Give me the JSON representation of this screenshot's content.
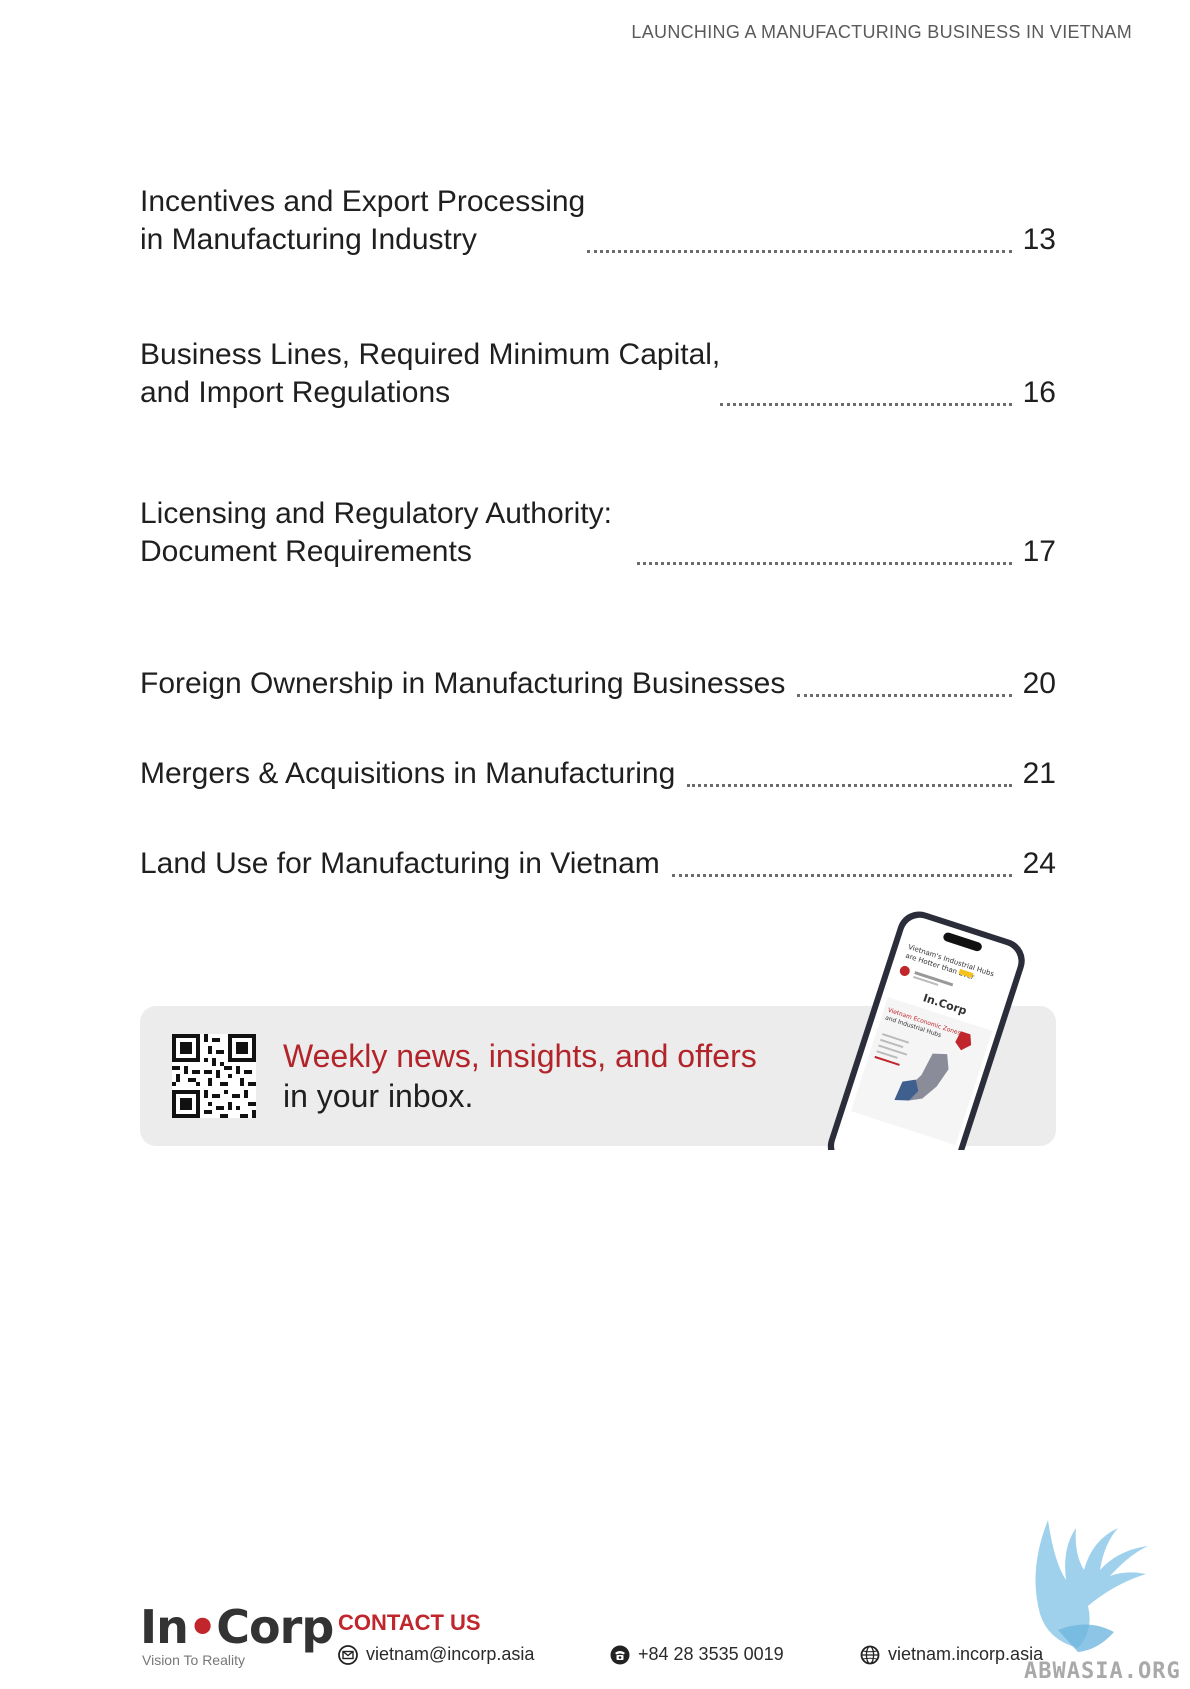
{
  "header": {
    "title": "LAUNCHING A MANUFACTURING BUSINESS IN VIETNAM"
  },
  "toc": [
    {
      "line1": "Incentives and Export Processing",
      "line2": "in Manufacturing Industry",
      "page": "13"
    },
    {
      "line1": "Business Lines, Required Minimum Capital,",
      "line2": "and Import Regulations",
      "page": "16"
    },
    {
      "line1": "Licensing and Regulatory Authority:",
      "line2": "Document Requirements",
      "page": "17"
    },
    {
      "line1": "",
      "line2": "Foreign Ownership in Manufacturing Businesses",
      "page": "20"
    },
    {
      "line1": "",
      "line2": "Mergers & Acquisitions in Manufacturing",
      "page": "21"
    },
    {
      "line1": "",
      "line2": "Land Use for Manufacturing in Vietnam",
      "page": "24"
    }
  ],
  "promo": {
    "headline": "Weekly news, insights, and offers",
    "subline": "in your inbox.",
    "qr_icon": "qr-code-icon",
    "phone": {
      "article_title_1": "Vietnam's Industrial Hubs",
      "article_title_2": "are Hotter than Ever",
      "logo": "In.Corp",
      "card_title_1": "Vietnam Economic Zones",
      "card_title_2": "and Industrial Hubs"
    }
  },
  "footer": {
    "logo_in": "In",
    "logo_corp": "Corp",
    "tagline": "Vision To Reality",
    "contact_heading": "CONTACT US",
    "email": "vietnam@incorp.asia",
    "phone": "+84 28 3535 0019",
    "website": "vietnam.incorp.asia",
    "email_icon": "envelope-icon",
    "phone_icon": "telephone-icon",
    "website_icon": "globe-icon"
  },
  "watermark": {
    "text": "ABWASIA.ORG"
  },
  "colors": {
    "accent": "#c0262c",
    "promo_bg": "#ececec",
    "text": "#1f1f1f"
  }
}
